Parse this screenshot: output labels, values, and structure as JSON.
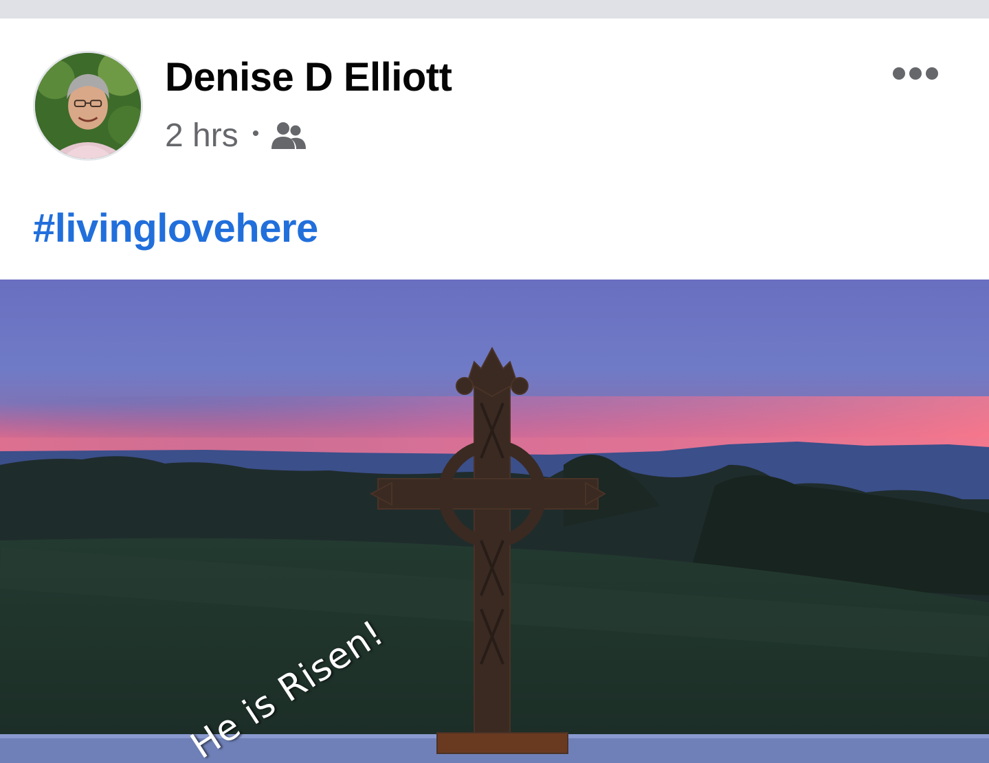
{
  "post": {
    "author_name": "Denise D Elliott",
    "timestamp": "2 hrs",
    "separator": "•",
    "audience_icon": "friends-icon",
    "more_icon": "more-options-icon",
    "hashtag": "#livinglovehere"
  },
  "photo": {
    "overlay_text": "He is Risen!",
    "subject": "silhouetted Celtic cross on a ledge at dusk over a lawn and distant hills"
  },
  "colors": {
    "author": "#050505",
    "meta": "#65676b",
    "hashtag": "#216fdb",
    "page_background": "#dfe1e6"
  }
}
